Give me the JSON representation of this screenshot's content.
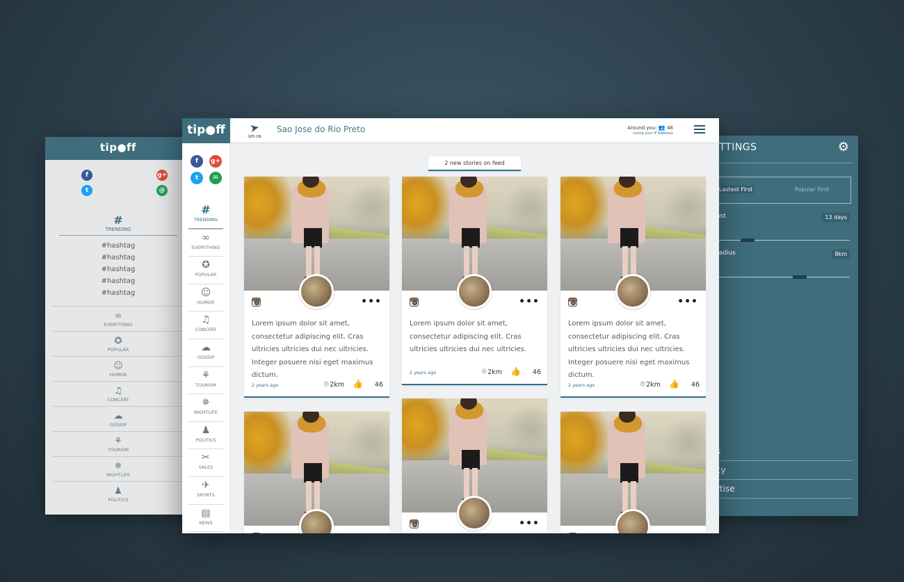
{
  "left_panel": {
    "logo": "tip●ff",
    "trending_icon": "#",
    "trending_label": "TRENDING",
    "hashtags": [
      "#hashtag",
      "#hashtag",
      "#hashtag",
      "#hashtag",
      "#hashtag"
    ],
    "categories": [
      {
        "icon": "infinity-icon",
        "glyph": "∞",
        "label": "EVERYTHING"
      },
      {
        "icon": "star-bubble-icon",
        "glyph": "✪",
        "label": "POPULAR"
      },
      {
        "icon": "masks-icon",
        "glyph": "☺",
        "label": "HUMOR"
      },
      {
        "icon": "music-note-icon",
        "glyph": "♫",
        "label": "CONCERT"
      },
      {
        "icon": "chat-bubbles-icon",
        "glyph": "☁",
        "label": "GOSSIP"
      },
      {
        "icon": "palm-tree-icon",
        "glyph": "⚘",
        "label": "TOURISM"
      },
      {
        "icon": "disco-ball-icon",
        "glyph": "✵",
        "label": "NIGHTLIFE"
      },
      {
        "icon": "politician-icon",
        "glyph": "♟",
        "label": "POLITICS"
      }
    ]
  },
  "settings_panel": {
    "title": "ETTINGS",
    "sort_options": [
      "Lastest First",
      "Popular First"
    ],
    "last_label": "ast",
    "last_value": "13 days",
    "last_slider_fraction": 0.35,
    "radius_label": "radius",
    "radius_value": "8km",
    "radius_slider_fraction": 0.7,
    "links": [
      "s",
      "cy",
      "rtise"
    ]
  },
  "app": {
    "logo": "tip●ff",
    "gps_label": "GPS ON",
    "city": "Sao Jose do Rio Preto",
    "around_label": "Around you:",
    "around_count": "46",
    "around_sub": "(using your IP Address)",
    "new_stories": "2 new stories on feed",
    "sidebar": [
      {
        "icon": "hash-icon",
        "glyph": "#",
        "label": "TRENDING",
        "active": true
      },
      {
        "icon": "infinity-icon",
        "glyph": "∞",
        "label": "EVERYTHING"
      },
      {
        "icon": "star-bubble-icon",
        "glyph": "✪",
        "label": "POPULAR"
      },
      {
        "icon": "masks-icon",
        "glyph": "☺",
        "label": "HUMOR"
      },
      {
        "icon": "music-note-icon",
        "glyph": "♫",
        "label": "CONCERT"
      },
      {
        "icon": "chat-bubbles-icon",
        "glyph": "☁",
        "label": "GOSSIP"
      },
      {
        "icon": "palm-tree-icon",
        "glyph": "⚘",
        "label": "TOURISM"
      },
      {
        "icon": "disco-ball-icon",
        "glyph": "✵",
        "label": "NIGHTLIFE"
      },
      {
        "icon": "politician-icon",
        "glyph": "♟",
        "label": "POLITICS"
      },
      {
        "icon": "tag-icon",
        "glyph": "✂",
        "label": "SALES"
      },
      {
        "icon": "runner-icon",
        "glyph": "✈",
        "label": "SPORTS"
      },
      {
        "icon": "newspaper-icon",
        "glyph": "▤",
        "label": "NEWS"
      }
    ],
    "cards": [
      {
        "text": "Lorem ipsum dolor sit amet, consectetur adipiscing elit. Cras ultricies ultricies dui nec ultricies. Integer posuere nisi eget maximus dictum.",
        "time": "2 years ago",
        "distance": "2km",
        "likes": "46"
      },
      {
        "text": "Lorem ipsum dolor sit amet, consectetur adipiscing elit. Cras ultricies ultricies dui nec ultricies.",
        "time": "2 years ago",
        "distance": "2km",
        "likes": "46"
      },
      {
        "text": "Lorem ipsum dolor sit amet, consectetur adipiscing elit. Cras ultricies ultricies dui nec ultricies. Integer posuere nisi eget maximus dictum.",
        "time": "2 years ago",
        "distance": "2km",
        "likes": "46"
      },
      {
        "text": "",
        "time": "",
        "distance": "",
        "likes": ""
      },
      {
        "text": "",
        "time": "",
        "distance": "",
        "likes": ""
      },
      {
        "text": "",
        "time": "",
        "distance": "",
        "likes": ""
      }
    ]
  },
  "colors": {
    "brand": "#3f6d7d",
    "accent": "#2d6d88",
    "facebook": "#3b5998",
    "googleplus": "#dd4b39",
    "twitter": "#1da1f2",
    "email": "#1e9e56"
  }
}
